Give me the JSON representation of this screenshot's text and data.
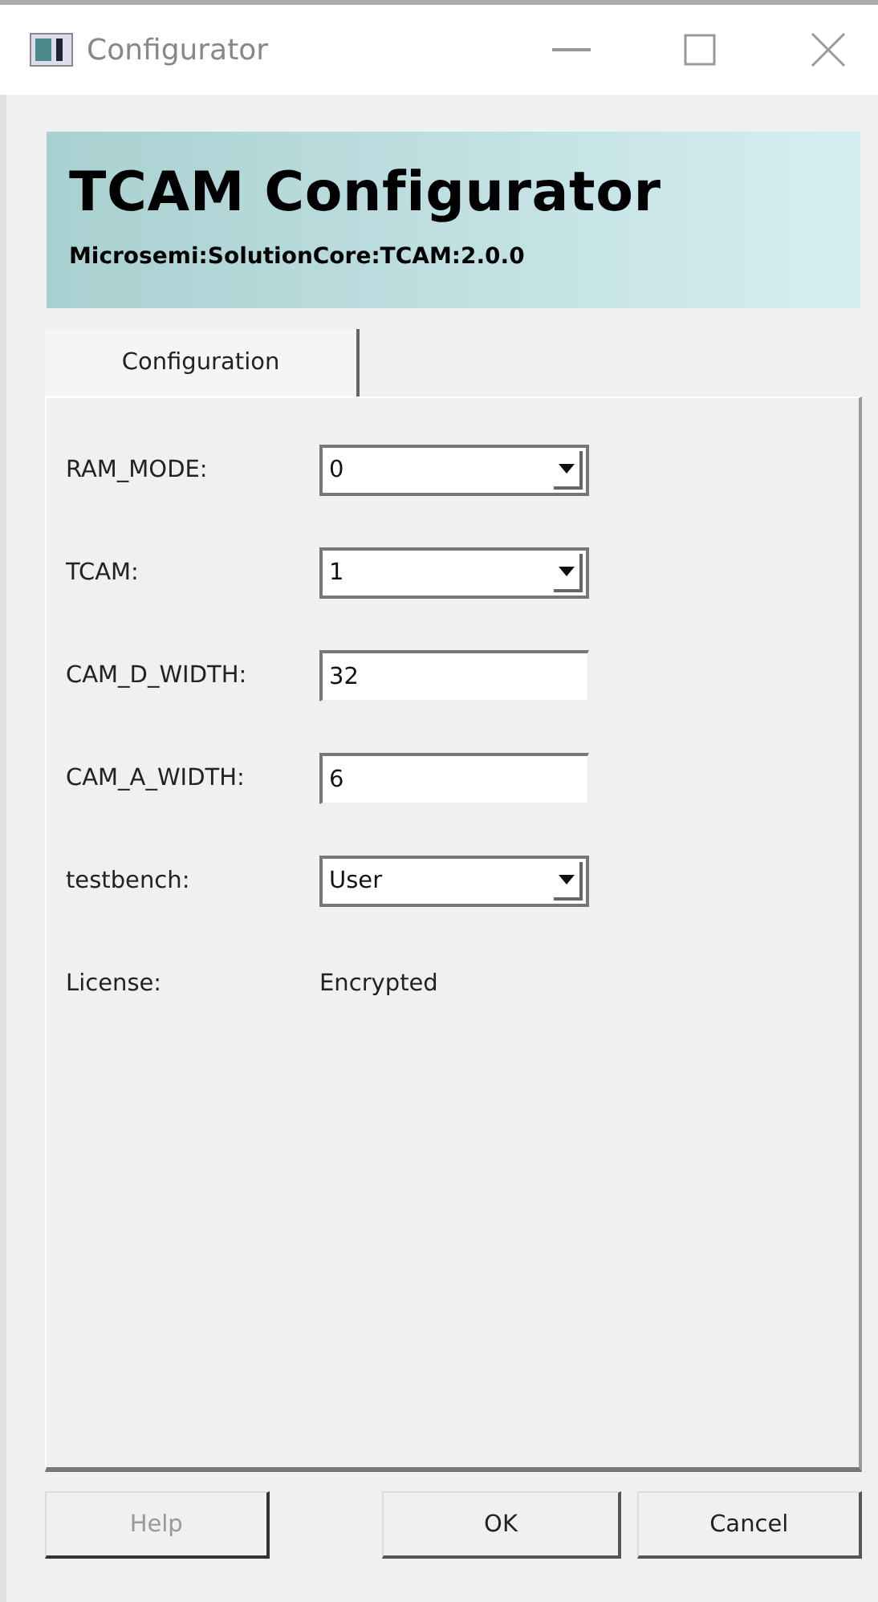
{
  "window": {
    "title": "Configurator"
  },
  "header": {
    "title": "TCAM Configurator",
    "subtitle": "Microsemi:SolutionCore:TCAM:2.0.0"
  },
  "tabs": [
    {
      "label": "Configuration",
      "selected": true
    }
  ],
  "fields": [
    {
      "kind": "dropdown",
      "label": "RAM_MODE:",
      "value": "0"
    },
    {
      "kind": "dropdown",
      "label": "TCAM:",
      "value": "1"
    },
    {
      "kind": "text",
      "label": "CAM_D_WIDTH:",
      "value": "32"
    },
    {
      "kind": "text",
      "label": "CAM_A_WIDTH:",
      "value": "6"
    },
    {
      "kind": "dropdown",
      "label": "testbench:",
      "value": "User"
    },
    {
      "kind": "static",
      "label": "License:",
      "value": "Encrypted"
    }
  ],
  "buttons": [
    {
      "label": "Help",
      "disabled": true
    },
    {
      "label": "OK",
      "disabled": false
    },
    {
      "label": "Cancel",
      "disabled": false
    }
  ]
}
